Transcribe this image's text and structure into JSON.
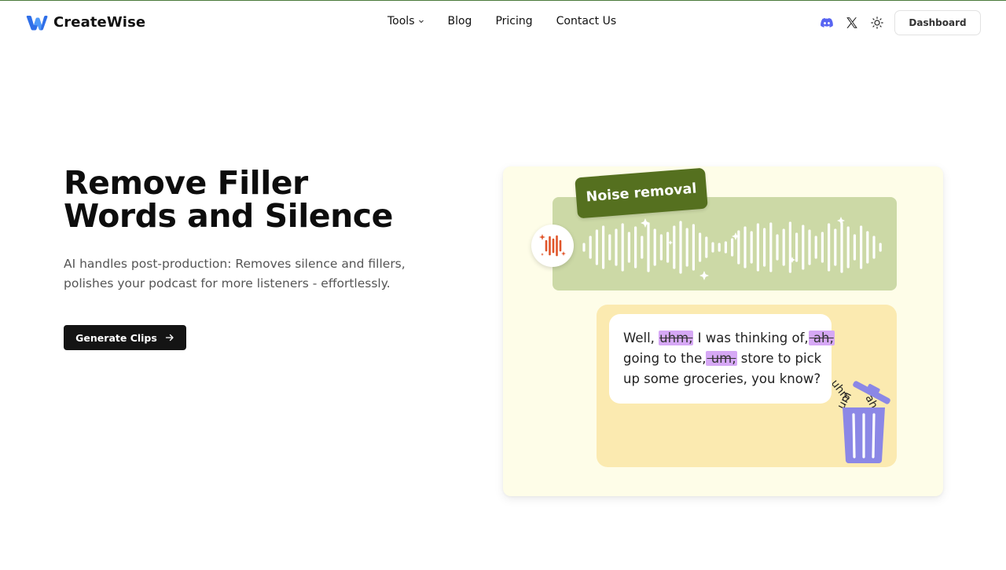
{
  "brand": {
    "name": "CreateWise",
    "accent": "#2f6fe8"
  },
  "nav": {
    "tools": "Tools",
    "blog": "Blog",
    "pricing": "Pricing",
    "contact": "Contact Us"
  },
  "header_actions": {
    "icons": [
      "discord-icon",
      "x-twitter-icon",
      "theme-toggle-icon"
    ],
    "dashboard": "Dashboard"
  },
  "hero": {
    "title_line1": "Remove Filler",
    "title_line2": "Words and Silence",
    "subtitle_line1": "AI handles post-production: Removes silence and fillers,",
    "subtitle_line2": "polishes your podcast for more listeners - effortlessly.",
    "cta": "Generate Clips"
  },
  "illustration": {
    "tag": "Noise removal",
    "transcript": {
      "l1_a": "Well, ",
      "l1_f1": "uhm,",
      "l1_b": " I was thinking of,",
      "l1_f2": " ah,",
      "l2_a": "going to the,",
      "l2_f": " um,",
      "l2_b": " store to pick",
      "l3": "up some groceries, you know?"
    },
    "trash_words": [
      "uhm",
      "um",
      "ah"
    ],
    "colors": {
      "card_bg": "#fefde8",
      "wave_panel": "#ccd9a6",
      "tag_bg": "#55701f",
      "text_panel": "#fbeab0",
      "filler_highlight": "#d6a8f5",
      "trash": "#8b87e6",
      "mic": "#e0552a"
    }
  }
}
